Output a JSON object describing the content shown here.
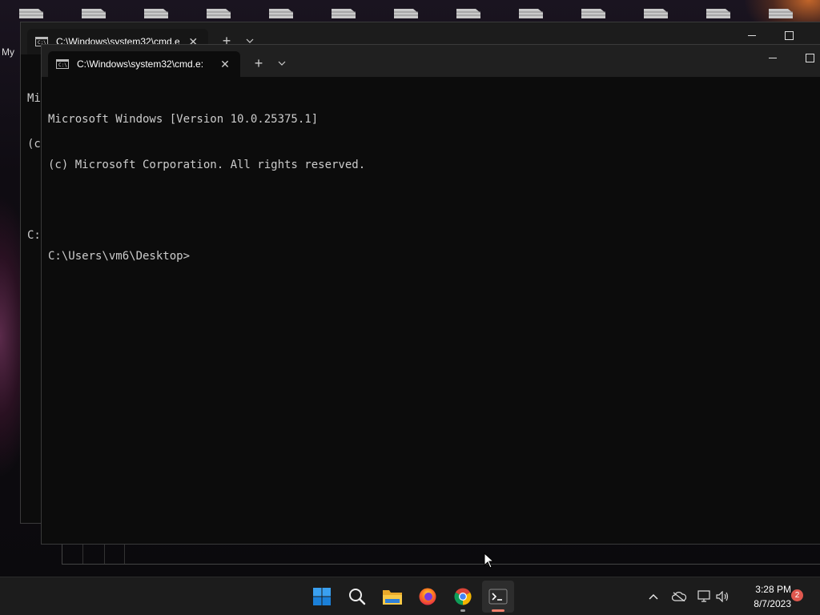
{
  "desktop": {
    "partial_label": "My"
  },
  "back_window": {
    "tab_title": "C:\\Windows\\system32\\cmd.e",
    "tab_icon_text": "C:\\",
    "close_glyph": "✕",
    "new_tab_glyph": "+",
    "console_lines": [
      "Mi",
      "(c",
      "",
      "C:"
    ]
  },
  "front_window": {
    "tab_title": "C:\\Windows\\system32\\cmd.e:",
    "tab_icon_text": "C:\\",
    "close_glyph": "✕",
    "new_tab_glyph": "+",
    "console_lines": [
      "Microsoft Windows [Version 10.0.25375.1]",
      "(c) Microsoft Corporation. All rights reserved.",
      "",
      "C:\\Users\\vm6\\Desktop>"
    ]
  },
  "taskbar": {
    "apps": [
      {
        "name": "start",
        "icon": "windows-logo-icon"
      },
      {
        "name": "search",
        "icon": "search-icon"
      },
      {
        "name": "file-explorer",
        "icon": "folder-icon"
      },
      {
        "name": "firefox",
        "icon": "firefox-icon"
      },
      {
        "name": "chrome",
        "icon": "chrome-icon",
        "running": true
      },
      {
        "name": "terminal",
        "icon": "terminal-icon",
        "active": true
      }
    ],
    "accent_color": "#0078d4",
    "active_indicator_color": "#f27f6b",
    "running_indicator_color": "#9a9a9a"
  },
  "tray": {
    "time": "3:28 PM",
    "date": "8/7/2023",
    "notification_count": "2"
  }
}
